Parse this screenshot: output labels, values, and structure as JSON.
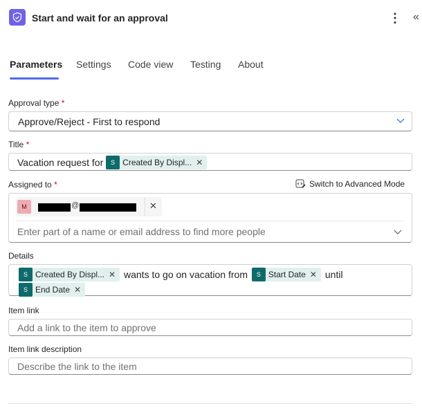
{
  "header": {
    "title": "Start and wait for an approval",
    "icon": "approval-shield-icon",
    "more": "⋮",
    "collapse": "«"
  },
  "tabs": [
    {
      "label": "Parameters",
      "active": true
    },
    {
      "label": "Settings"
    },
    {
      "label": "Code view"
    },
    {
      "label": "Testing"
    },
    {
      "label": "About"
    }
  ],
  "fields": {
    "approval_type": {
      "label": "Approval type",
      "required": "*",
      "value": "Approve/Reject - First to respond"
    },
    "title": {
      "label": "Title",
      "required": "*",
      "text": "Vacation request for",
      "token": "Created By Displ..."
    },
    "assigned_to": {
      "label": "Assigned to",
      "required": "*",
      "advanced_mode": "Switch to Advanced Mode",
      "person_initial": "M",
      "email_at": "@",
      "placeholder": "Enter part of a name or email address to find more people"
    },
    "details": {
      "label": "Details",
      "token1": "Created By Displ...",
      "text1": "wants to go on vacation from",
      "token2": "Start Date",
      "text2": "until",
      "token3": "End Date"
    },
    "item_link": {
      "label": "Item link",
      "placeholder": "Add a link to the item to approve"
    },
    "item_link_description": {
      "label": "Item link description",
      "placeholder": "Describe the link to the item"
    }
  },
  "colors": {
    "accent": "#4f6bed",
    "token_bg": "#e1efef",
    "token_icon": "#0f6b6b",
    "header_icon": "#7160e8"
  }
}
